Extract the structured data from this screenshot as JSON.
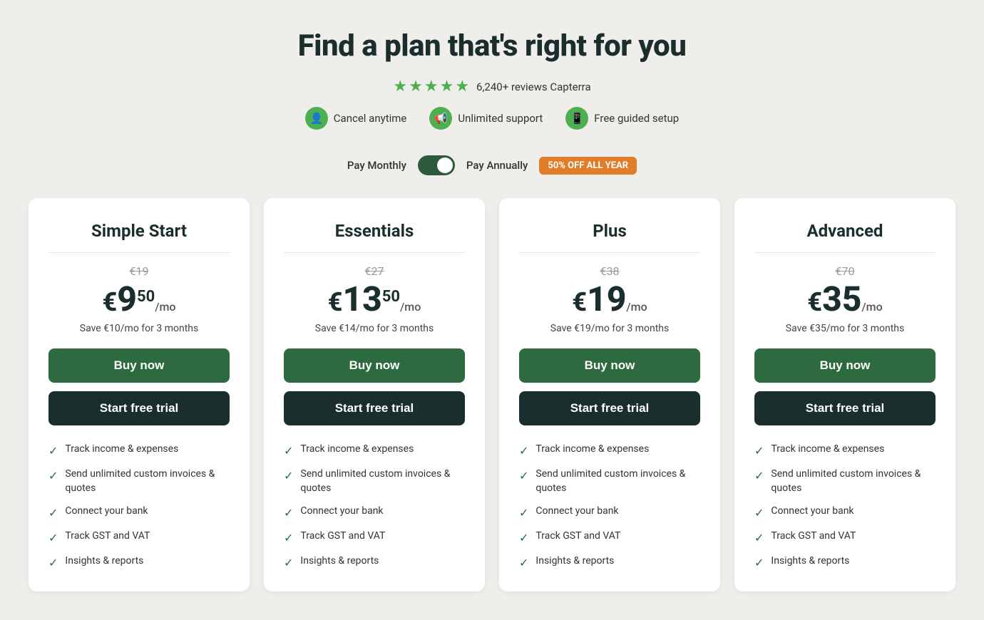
{
  "page": {
    "title": "Find a plan that's right for you"
  },
  "reviews": {
    "stars": 4.5,
    "count": "6,240+",
    "platform": "reviews Capterra"
  },
  "features_row": [
    {
      "id": "cancel",
      "icon": "👤",
      "text": "Cancel anytime"
    },
    {
      "id": "support",
      "icon": "📢",
      "text": "Unlimited support"
    },
    {
      "id": "setup",
      "icon": "📱",
      "text": "Free guided setup"
    }
  ],
  "billing": {
    "monthly_label": "Pay Monthly",
    "annually_label": "Pay Annually",
    "discount_badge": "50% OFF ALL YEAR"
  },
  "plans": [
    {
      "id": "simple-start",
      "name": "Simple Start",
      "original_price": "€19",
      "price_currency": "€",
      "price_whole": "9",
      "price_decimal": "50",
      "price_period": "/mo",
      "save_text": "Save €10/mo for 3 months",
      "buy_label": "Buy now",
      "trial_label": "Start free trial",
      "features": [
        "Track income & expenses",
        "Send unlimited custom invoices & quotes",
        "Connect your bank",
        "Track GST and VAT",
        "Insights & reports"
      ]
    },
    {
      "id": "essentials",
      "name": "Essentials",
      "original_price": "€27",
      "price_currency": "€",
      "price_whole": "13",
      "price_decimal": "50",
      "price_period": "/mo",
      "save_text": "Save €14/mo for 3 months",
      "buy_label": "Buy now",
      "trial_label": "Start free trial",
      "features": [
        "Track income & expenses",
        "Send unlimited custom invoices & quotes",
        "Connect your bank",
        "Track GST and VAT",
        "Insights & reports"
      ]
    },
    {
      "id": "plus",
      "name": "Plus",
      "original_price": "€38",
      "price_currency": "€",
      "price_whole": "19",
      "price_decimal": "",
      "price_period": "/mo",
      "save_text": "Save €19/mo for 3 months",
      "buy_label": "Buy now",
      "trial_label": "Start free trial",
      "features": [
        "Track income & expenses",
        "Send unlimited custom invoices & quotes",
        "Connect your bank",
        "Track GST and VAT",
        "Insights & reports"
      ]
    },
    {
      "id": "advanced",
      "name": "Advanced",
      "original_price": "€70",
      "price_currency": "€",
      "price_whole": "35",
      "price_decimal": "",
      "price_period": "/mo",
      "save_text": "Save €35/mo for 3 months",
      "buy_label": "Buy now",
      "trial_label": "Start free trial",
      "features": [
        "Track income & expenses",
        "Send unlimited custom invoices & quotes",
        "Connect your bank",
        "Track GST and VAT",
        "Insights & reports"
      ]
    }
  ]
}
